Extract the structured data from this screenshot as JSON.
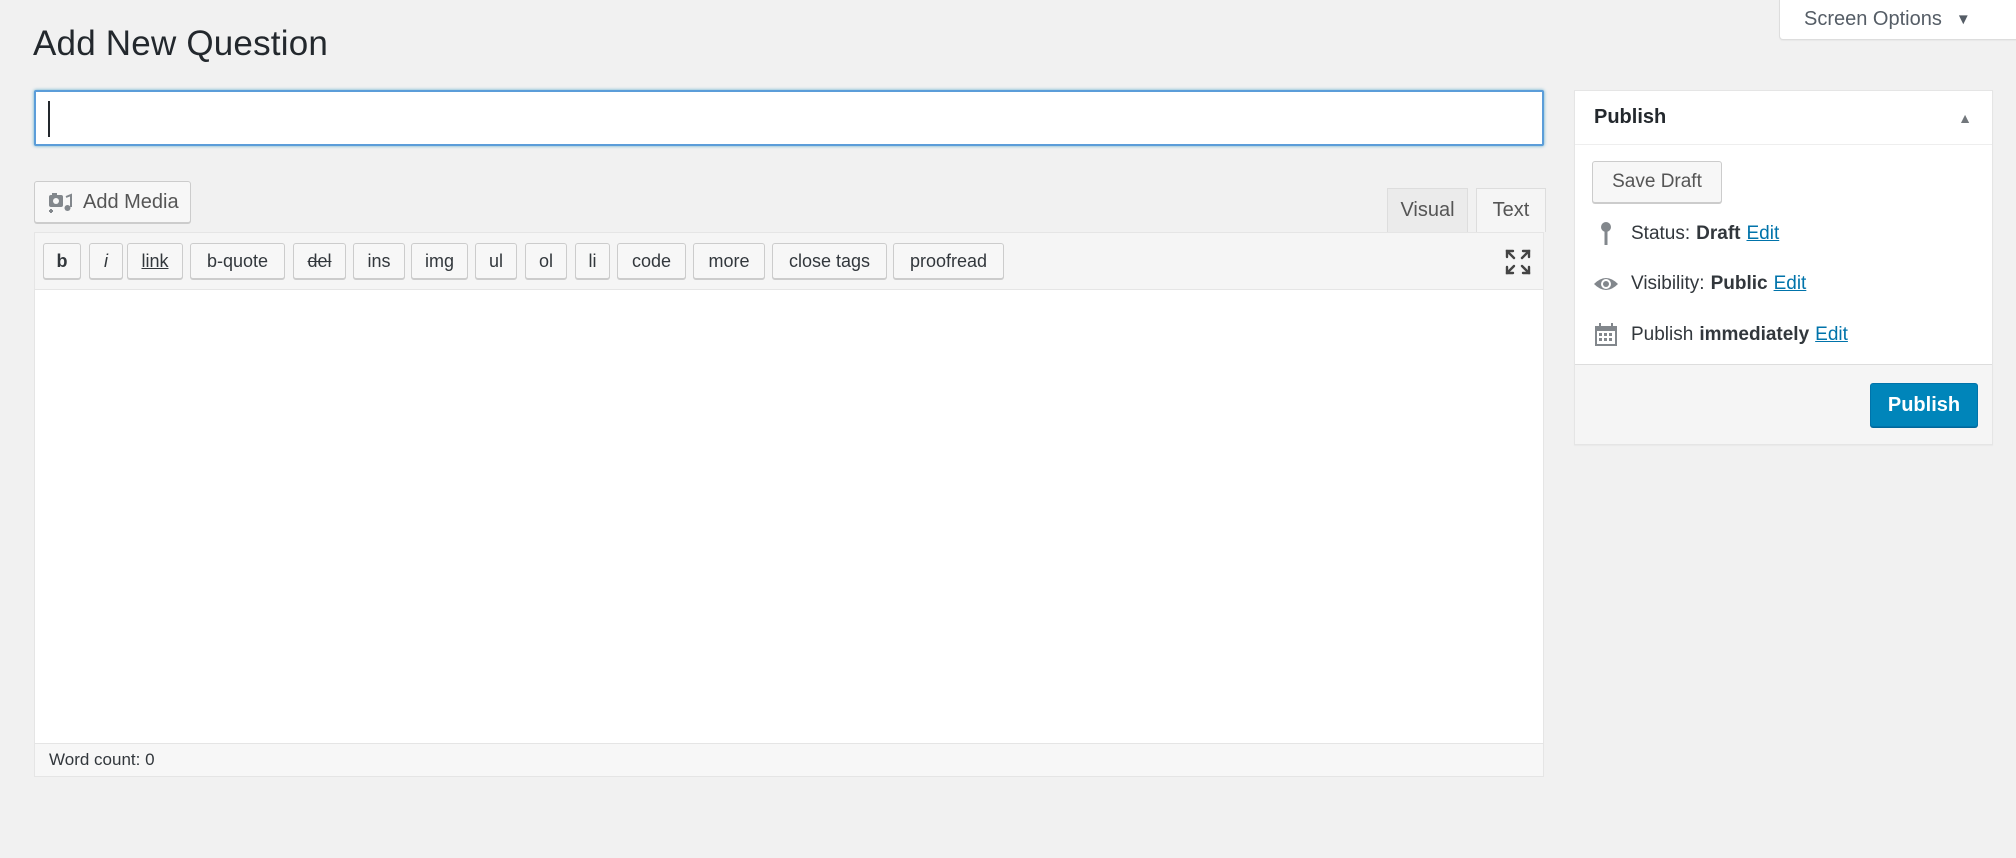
{
  "screen_options": {
    "label": "Screen Options",
    "caret": "▼"
  },
  "page_title": "Add New Question",
  "title_input": {
    "value": "",
    "placeholder": ""
  },
  "add_media": {
    "label": "Add Media",
    "icon": "add-media-icon"
  },
  "editor_tabs": {
    "visual": "Visual",
    "text": "Text",
    "active": "text"
  },
  "quicktags": [
    {
      "label": "b",
      "style": "bold"
    },
    {
      "label": "i",
      "style": "italic"
    },
    {
      "label": "link",
      "style": "link"
    },
    {
      "label": "b-quote",
      "style": ""
    },
    {
      "label": "del",
      "style": "del"
    },
    {
      "label": "ins",
      "style": ""
    },
    {
      "label": "img",
      "style": ""
    },
    {
      "label": "ul",
      "style": ""
    },
    {
      "label": "ol",
      "style": ""
    },
    {
      "label": "li",
      "style": ""
    },
    {
      "label": "code",
      "style": ""
    },
    {
      "label": "more",
      "style": ""
    },
    {
      "label": "close tags",
      "style": ""
    },
    {
      "label": "proofread",
      "style": ""
    }
  ],
  "editor": {
    "content": "",
    "word_count": "Word count: 0"
  },
  "publish_box": {
    "title": "Publish",
    "toggle": "▲",
    "save_draft": "Save Draft",
    "status_label": "Status:",
    "status_value": "Draft",
    "visibility_label": "Visibility:",
    "visibility_value": "Public",
    "schedule_label": "Publish",
    "schedule_value": "immediately",
    "edit_label": "Edit",
    "publish_button": "Publish"
  },
  "colors": {
    "accent": "#0085ba",
    "link": "#0073aa",
    "focus": "#5b9dd9",
    "background": "#f1f1f1"
  }
}
